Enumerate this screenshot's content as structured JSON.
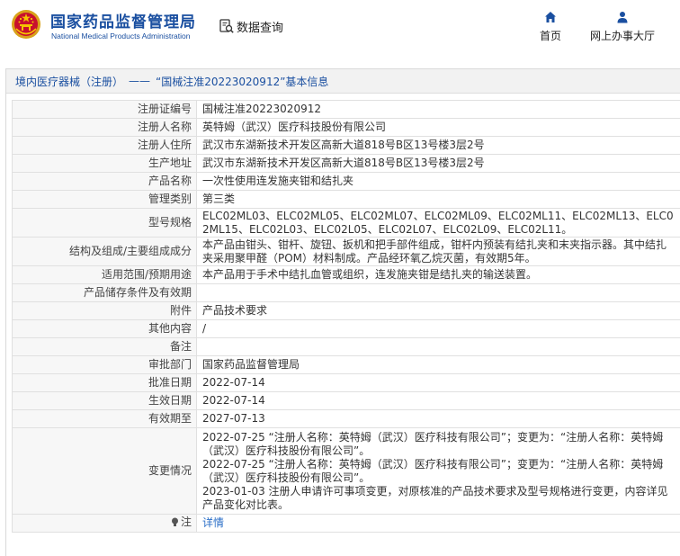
{
  "header": {
    "org_name_cn": "国家药品监督管理局",
    "org_name_en": "National Medical Products Administration",
    "search_label": "数据查询",
    "nav": [
      {
        "label": "首页",
        "icon": "home-icon"
      },
      {
        "label": "网上办事大厅",
        "icon": "user-icon"
      }
    ],
    "brand_color": "#1a4fa0"
  },
  "panel": {
    "breadcrumb_part1": "境内医疗器械（注册）",
    "breadcrumb_sep": "——",
    "breadcrumb_part2": "“国械注准20223020912”基本信息"
  },
  "rows": [
    {
      "label": "注册证编号",
      "value": "国械注准20223020912"
    },
    {
      "label": "注册人名称",
      "value": "英特姆（武汉）医疗科技股份有限公司"
    },
    {
      "label": "注册人住所",
      "value": "武汉市东湖新技术开发区高新大道818号B区13号楼3层2号"
    },
    {
      "label": "生产地址",
      "value": "武汉市东湖新技术开发区高新大道818号B区13号楼3层2号"
    },
    {
      "label": "产品名称",
      "value": "一次性使用连发施夹钳和结扎夹"
    },
    {
      "label": "管理类别",
      "value": "第三类"
    },
    {
      "label": "型号规格",
      "value": "ELC02ML03、ELC02ML05、ELC02ML07、ELC02ML09、ELC02ML11、ELC02ML13、ELC02ML15、ELC02L03、ELC02L05、ELC02L07、ELC02L09、ELC02L11。"
    },
    {
      "label": "结构及组成/主要组成成分",
      "value": "本产品由钳头、钳杆、旋钮、扳机和把手部件组成，钳杆内预装有结扎夹和末夹指示器。其中结扎夹采用聚甲醛（POM）材料制成。产品经环氧乙烷灭菌，有效期5年。"
    },
    {
      "label": "适用范围/预期用途",
      "value": "本产品用于手术中结扎血管或组织，连发施夹钳是结扎夹的输送装置。"
    },
    {
      "label": "产品储存条件及有效期",
      "value": ""
    },
    {
      "label": "附件",
      "value": "产品技术要求"
    },
    {
      "label": "其他内容",
      "value": "/"
    },
    {
      "label": "备注",
      "value": ""
    },
    {
      "label": "审批部门",
      "value": "国家药品监督管理局"
    },
    {
      "label": "批准日期",
      "value": "2022-07-14"
    },
    {
      "label": "生效日期",
      "value": "2022-07-14"
    },
    {
      "label": "有效期至",
      "value": "2027-07-13"
    }
  ],
  "change": {
    "label": "变更情况",
    "lines": [
      "2022-07-25 “注册人名称：英特姆（武汉）医疗科技有限公司”；变更为：“注册人名称：英特姆（武汉）医疗科技股份有限公司”。",
      "2022-07-25 “注册人名称：英特姆（武汉）医疗科技有限公司”；变更为：“注册人名称：英特姆（武汉）医疗科技股份有限公司”。",
      "2023-01-03 注册人申请许可事项变更，对原核准的产品技术要求及型号规格进行变更，内容详见产品变化对比表。"
    ]
  },
  "note": {
    "label": "注",
    "icon": "lightbulb-icon",
    "link_text": "详情",
    "link_color": "#2a6ec7"
  }
}
